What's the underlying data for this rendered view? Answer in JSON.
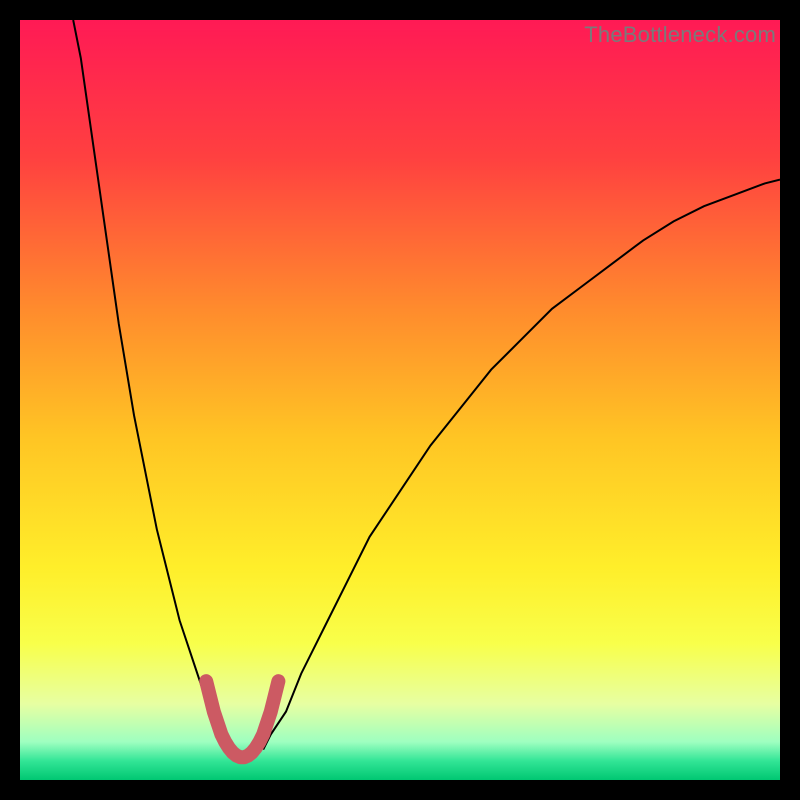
{
  "watermark": "TheBottleneck.com",
  "chart_data": {
    "type": "line",
    "title": "",
    "xlabel": "",
    "ylabel": "",
    "xlim": [
      0,
      100
    ],
    "ylim": [
      0,
      100
    ],
    "grid": false,
    "legend": false,
    "gradient_stops": [
      {
        "pos": 0.0,
        "color": "#ff1a55"
      },
      {
        "pos": 0.18,
        "color": "#ff4040"
      },
      {
        "pos": 0.38,
        "color": "#ff8b2d"
      },
      {
        "pos": 0.55,
        "color": "#ffc524"
      },
      {
        "pos": 0.72,
        "color": "#ffee2a"
      },
      {
        "pos": 0.82,
        "color": "#f8ff4a"
      },
      {
        "pos": 0.9,
        "color": "#e7ffa2"
      },
      {
        "pos": 0.95,
        "color": "#9effc0"
      },
      {
        "pos": 0.975,
        "color": "#32e596"
      },
      {
        "pos": 1.0,
        "color": "#00c772"
      }
    ],
    "series": [
      {
        "name": "bottleneck-curve-left",
        "stroke": "#000000",
        "width": 2,
        "x": [
          7,
          8,
          9,
          10,
          11,
          12,
          13,
          14,
          15,
          16,
          17,
          18,
          19,
          20,
          21,
          22,
          23,
          24,
          25,
          26,
          27,
          27.5
        ],
        "y": [
          100,
          95,
          88,
          81,
          74,
          67,
          60,
          54,
          48,
          43,
          38,
          33,
          29,
          25,
          21,
          18,
          15,
          12,
          9,
          7,
          5,
          4
        ]
      },
      {
        "name": "bottleneck-curve-right",
        "stroke": "#000000",
        "width": 2,
        "x": [
          32,
          33,
          35,
          37,
          40,
          43,
          46,
          50,
          54,
          58,
          62,
          66,
          70,
          74,
          78,
          82,
          86,
          90,
          94,
          98,
          100
        ],
        "y": [
          4,
          6,
          9,
          14,
          20,
          26,
          32,
          38,
          44,
          49,
          54,
          58,
          62,
          65,
          68,
          71,
          73.5,
          75.5,
          77,
          78.5,
          79
        ]
      },
      {
        "name": "optimal-range-marker",
        "stroke": "#cc5a63",
        "width": 14,
        "linecap": "round",
        "x": [
          24.5,
          25,
          25.5,
          26,
          26.5,
          27,
          27.5,
          28,
          28.5,
          29,
          29.5,
          30,
          30.5,
          31,
          31.5,
          32,
          32.5,
          33,
          33.5,
          34
        ],
        "y": [
          13,
          11,
          9,
          7.5,
          6,
          5,
          4.2,
          3.6,
          3.2,
          3,
          3,
          3.2,
          3.6,
          4.2,
          5,
          6,
          7.5,
          9,
          11,
          13
        ]
      }
    ]
  }
}
